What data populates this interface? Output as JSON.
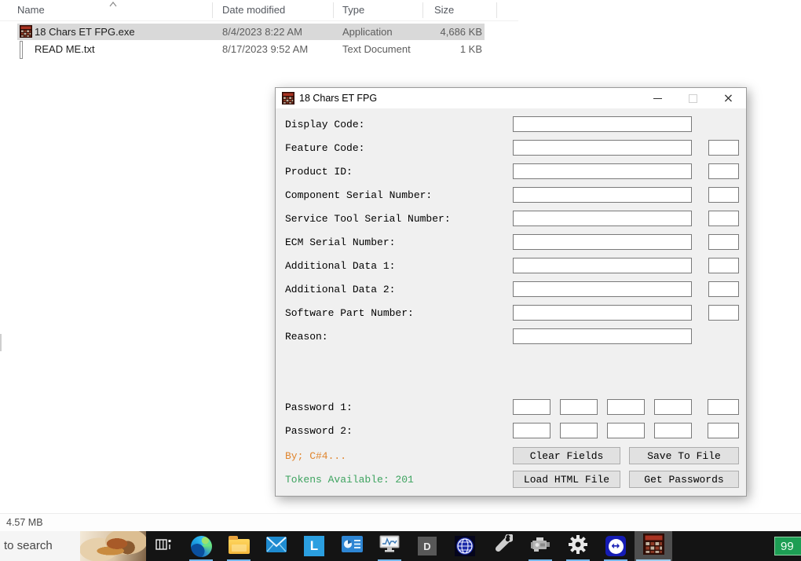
{
  "explorer": {
    "columns": [
      "Name",
      "Date modified",
      "Type",
      "Size"
    ],
    "rows": [
      {
        "name": "18 Chars ET FPG.exe",
        "date_modified": "8/4/2023 8:22 AM",
        "type": "Application",
        "size": "4,686 KB"
      },
      {
        "name": "READ ME.txt",
        "date_modified": "8/17/2023 9:52 AM",
        "type": "Text Document",
        "size": "1 KB"
      }
    ],
    "status_bar": "4.57 MB"
  },
  "dialog": {
    "title": "18 Chars ET FPG",
    "fields": [
      {
        "label": "Display Code:",
        "value": ""
      },
      {
        "label": "Feature Code:",
        "value": ""
      },
      {
        "label": "Product ID:",
        "value": ""
      },
      {
        "label": "Component Serial Number:",
        "value": ""
      },
      {
        "label": "Service Tool Serial Number:",
        "value": ""
      },
      {
        "label": "ECM Serial Number:",
        "value": ""
      },
      {
        "label": "Additional Data 1:",
        "value": ""
      },
      {
        "label": "Additional Data 2:",
        "value": ""
      },
      {
        "label": "Software Part Number:",
        "value": ""
      },
      {
        "label": "Reason:",
        "value": ""
      }
    ],
    "passwords": [
      {
        "label": "Password 1:"
      },
      {
        "label": "Password 2:"
      }
    ],
    "credit": "By; C#4...",
    "tokens": "Tokens Available: 201",
    "buttons": {
      "clear": "Clear Fields",
      "save": "Save To File",
      "load": "Load HTML File",
      "get": "Get Passwords"
    },
    "colors": {
      "credit_text": "#e0862f",
      "tokens_text": "#3da35f"
    }
  },
  "taskbar": {
    "search_text": "to search",
    "overflow_badge": "99",
    "icons": [
      "task-view",
      "edge-browser",
      "file-explorer",
      "mail",
      "l-app",
      "report-app",
      "performance-monitor",
      "d-app",
      "globe-app",
      "wrench-tool",
      "engine-app",
      "settings-gear",
      "teamviewer",
      "calculator-app"
    ]
  },
  "window_controls": {
    "close": "×"
  }
}
